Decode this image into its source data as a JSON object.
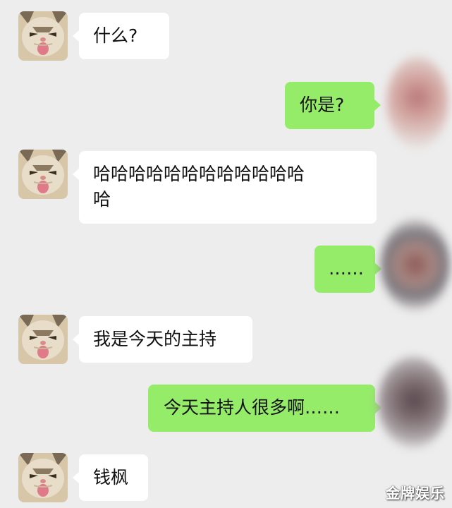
{
  "messages": [
    {
      "side": "in",
      "text": "什么?"
    },
    {
      "side": "out",
      "text": "你是?"
    },
    {
      "side": "in",
      "line1": "哈哈哈哈哈哈哈哈哈哈哈哈",
      "line2": "哈"
    },
    {
      "side": "out",
      "text": "……"
    },
    {
      "side": "in",
      "text": "我是今天的主持"
    },
    {
      "side": "out",
      "text": "今天主持人很多啊……"
    },
    {
      "side": "in",
      "text": "钱枫"
    }
  ],
  "watermark": "金牌娱乐",
  "colors": {
    "background": "#ededed",
    "incoming_bubble": "#ffffff",
    "outgoing_bubble": "#95ec69"
  },
  "icons": {
    "incoming_avatar": "cat-avatar-icon",
    "outgoing_avatar": "blurred-avatar"
  }
}
